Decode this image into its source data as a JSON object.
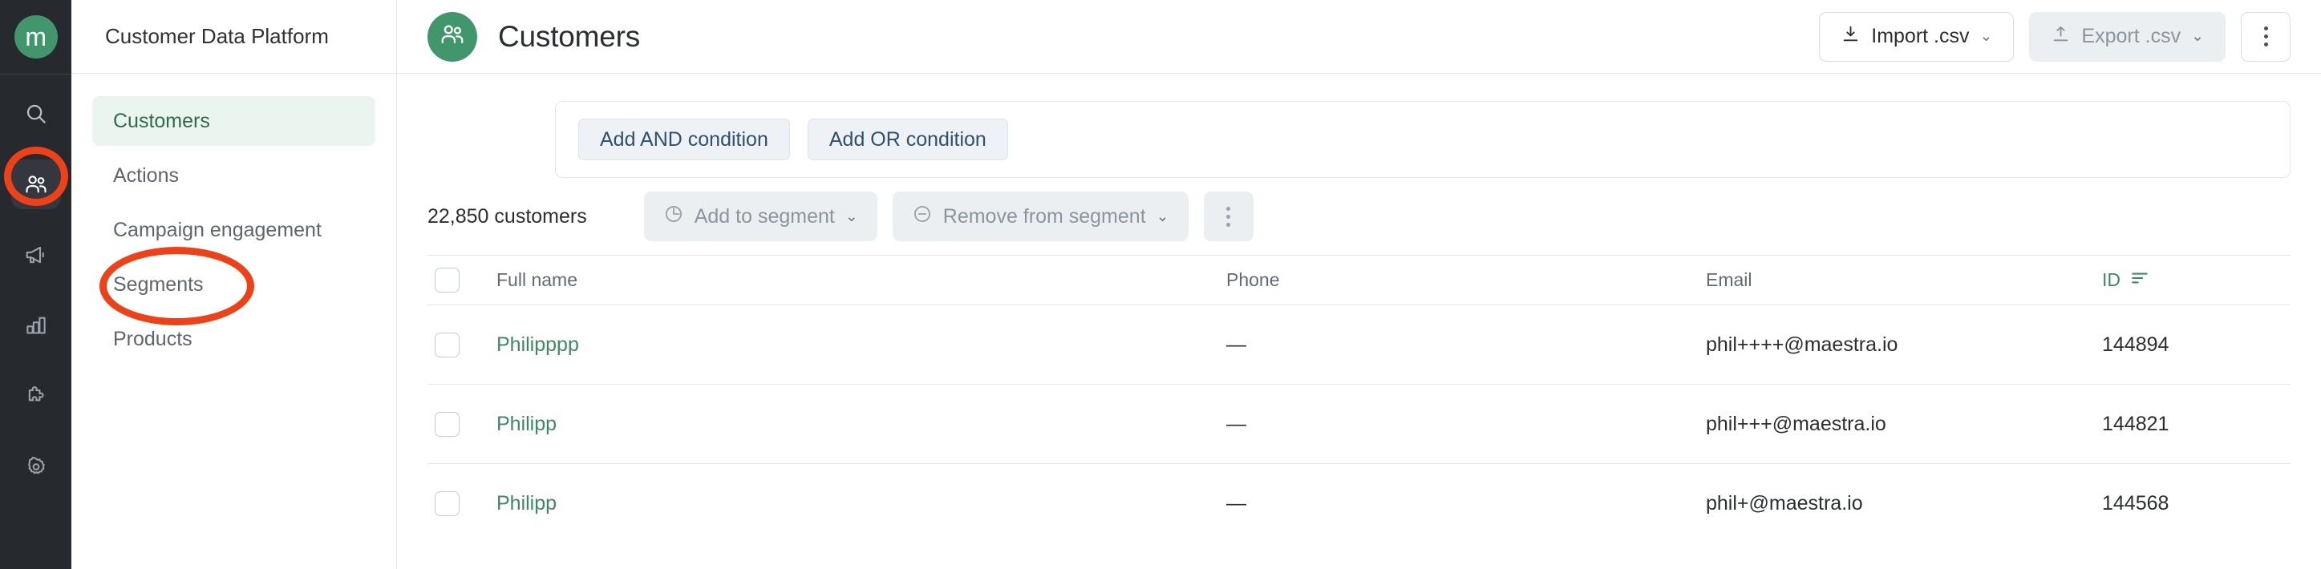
{
  "brand": {
    "logo_letter": "m",
    "accent": "#41976b",
    "annotation_color": "#ee4118"
  },
  "rail": {
    "items": [
      {
        "name": "search-icon",
        "label": "Search",
        "active": false
      },
      {
        "name": "customers-icon",
        "label": "Customers",
        "active": true
      },
      {
        "name": "megaphone-icon",
        "label": "Campaigns",
        "active": false
      },
      {
        "name": "bar-chart-icon",
        "label": "Analytics",
        "active": false
      },
      {
        "name": "puzzle-icon",
        "label": "Integrations",
        "active": false
      },
      {
        "name": "gear-icon",
        "label": "Settings",
        "active": false
      }
    ]
  },
  "sidebar": {
    "title": "Customer Data Platform",
    "items": [
      {
        "label": "Customers",
        "active": true
      },
      {
        "label": "Actions",
        "active": false
      },
      {
        "label": "Campaign engagement",
        "active": false
      },
      {
        "label": "Segments",
        "active": false
      },
      {
        "label": "Products",
        "active": false
      }
    ]
  },
  "header": {
    "title": "Customers",
    "avatar_icon": "customers-icon",
    "import_label": "Import .csv",
    "import_icon": "download-icon",
    "export_label": "Export .csv",
    "export_icon": "upload-icon",
    "chevron": "⌄",
    "more_icon": "kebab-menu-icon"
  },
  "conditions": {
    "add_and_label": "Add AND condition",
    "add_or_label": "Add OR condition"
  },
  "toolbar": {
    "count_label": "22,850 customers",
    "add_to_segment_label": "Add to segment",
    "add_to_segment_icon": "pie-clock-icon",
    "remove_from_segment_label": "Remove from segment",
    "remove_from_segment_icon": "minus-circle-icon",
    "chevron": "⌄",
    "more_icon": "kebab-menu-icon"
  },
  "table": {
    "columns": [
      {
        "key": "name",
        "label": "Full name",
        "sorted": false
      },
      {
        "key": "phone",
        "label": "Phone",
        "sorted": false
      },
      {
        "key": "email",
        "label": "Email",
        "sorted": false
      },
      {
        "key": "id",
        "label": "ID",
        "sorted": true,
        "sort_icon": "sort-descending-icon"
      }
    ],
    "rows": [
      {
        "name": "Philipppp",
        "phone": "—",
        "email": "phil++++@maestra.io",
        "id": "144894"
      },
      {
        "name": "Philipp",
        "phone": "—",
        "email": "phil+++@maestra.io",
        "id": "144821"
      },
      {
        "name": "Philipp",
        "phone": "—",
        "email": "phil+@maestra.io",
        "id": "144568"
      }
    ]
  },
  "annotations": [
    {
      "name": "annotation-circle-customers-rail-icon",
      "target": "rail customers icon"
    },
    {
      "name": "annotation-circle-segments-nav-item",
      "target": "sidebar Segments item"
    }
  ]
}
